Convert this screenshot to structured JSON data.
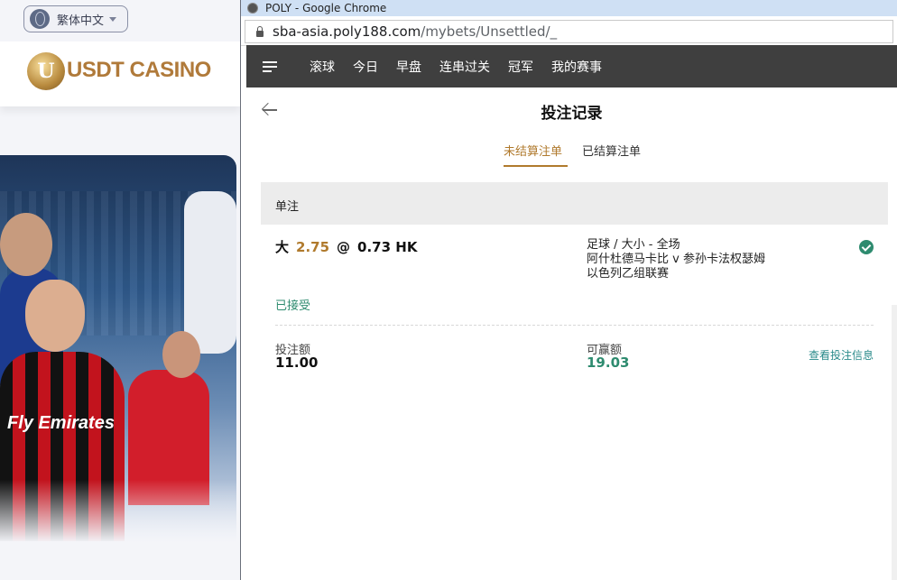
{
  "left_site": {
    "language": "繁体中文",
    "logo_text": "USDT CASINO",
    "logo_mark": "U",
    "banner_text": "Fly Emirates"
  },
  "browser": {
    "window_title": "POLY - Google Chrome",
    "url_host": "sba-asia.poly188.com",
    "url_path": "/mybets/Unsettled/_"
  },
  "nav": {
    "items": [
      "滚球",
      "今日",
      "早盘",
      "连串过关",
      "冠军",
      "我的赛事"
    ]
  },
  "page": {
    "title": "投注记录",
    "tabs": [
      "未结算注单",
      "已结算注单"
    ],
    "active_tab": "未结算注单",
    "section_label": "单注"
  },
  "bet": {
    "selection": "大",
    "handicap": "2.75",
    "at": "@",
    "odds": "0.73 HK",
    "market": "足球 / 大小 - 全场",
    "match": "阿什杜德马卡比 v 参孙卡法权瑟姆",
    "league": "以色列乙组联赛",
    "status": "已接受",
    "stake_label": "投注额",
    "stake_value": "11.00",
    "win_label": "可赢额",
    "win_value": "19.03",
    "details_link": "查看投注信息"
  },
  "colors": {
    "accent": "#b07a2d",
    "success": "#2e8b6f",
    "navbar": "#3f3f3f"
  }
}
